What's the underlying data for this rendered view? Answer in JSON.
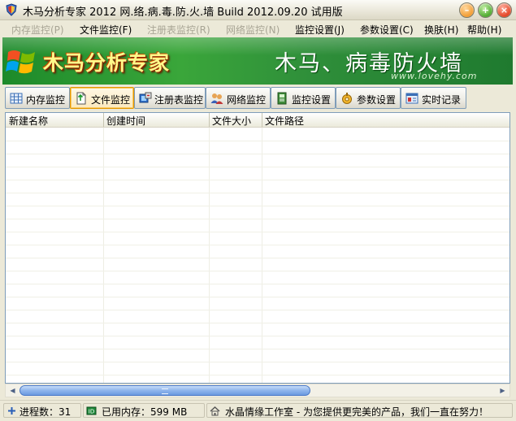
{
  "titlebar": {
    "title": "木马分析专家 2012 网.络.病.毒.防.火.墙 Build 2012.09.20 试用版",
    "buttons": [
      "minimize",
      "maximize",
      "close"
    ]
  },
  "menubar": {
    "items": [
      {
        "label": "内存监控(P)",
        "enabled": false
      },
      {
        "label": "文件监控(F)",
        "enabled": true
      },
      {
        "label": "注册表监控(R)",
        "enabled": false
      },
      {
        "label": "网络监控(N)",
        "enabled": false
      },
      {
        "label": "监控设置(J)",
        "enabled": true
      },
      {
        "label": "参数设置(C)",
        "enabled": true
      },
      {
        "label": "换肤(H)",
        "enabled": true
      },
      {
        "label": "帮助(H)",
        "enabled": true
      }
    ]
  },
  "banner": {
    "title": "木马分析专家",
    "slogan": "木马、病毒防火墙",
    "url": "www.lovehy.com"
  },
  "toolbar": {
    "buttons": [
      {
        "label": "内存监控",
        "icon": "memory-grid-icon",
        "active": false
      },
      {
        "label": "文件监控",
        "icon": "file-monitor-icon",
        "active": true
      },
      {
        "label": "注册表监控",
        "icon": "registry-icon",
        "active": false
      },
      {
        "label": "网络监控",
        "icon": "network-users-icon",
        "active": false
      },
      {
        "label": "监控设置",
        "icon": "monitor-settings-icon",
        "active": false
      },
      {
        "label": "参数设置",
        "icon": "parameter-settings-icon",
        "active": false
      },
      {
        "label": "实时记录",
        "icon": "realtime-log-icon",
        "active": false
      }
    ]
  },
  "list": {
    "columns": [
      "新建名称",
      "创建时间",
      "文件大小",
      "文件路径"
    ],
    "rows": []
  },
  "statusbar": {
    "process_count": "进程数：31",
    "memory_used": "已用内存：599 MB",
    "message": "水晶情缘工作室 - 为您提供更完美的产品，我们一直在努力！"
  },
  "colors": {
    "banner_green": "#2f8f3a",
    "banner_title": "#fffa8a",
    "active_button_border": "#e59700",
    "scroll_thumb": "#8fb5ec"
  }
}
